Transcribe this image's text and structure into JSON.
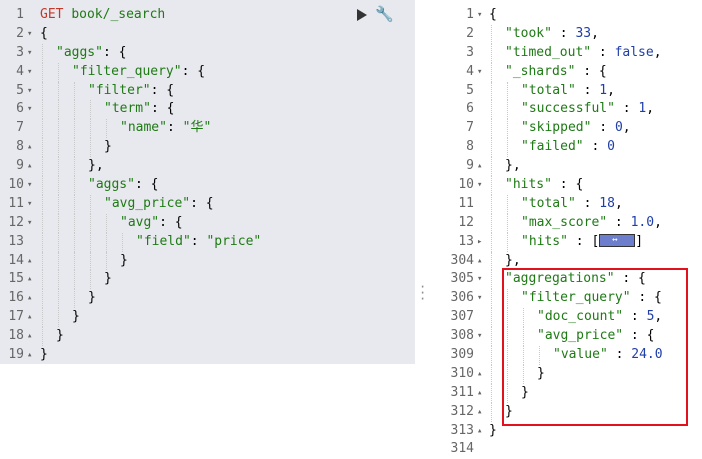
{
  "request": {
    "method": "GET",
    "endpoint": "book/_search",
    "lines": [
      {
        "n": "1",
        "fold": "",
        "indent": 0,
        "parts": []
      },
      {
        "n": "2",
        "fold": "▾",
        "indent": 0,
        "parts": [
          [
            "p",
            "{"
          ]
        ]
      },
      {
        "n": "3",
        "fold": "▾",
        "indent": 1,
        "parts": [
          [
            "s",
            "\"aggs\""
          ],
          [
            "p",
            ": {"
          ]
        ]
      },
      {
        "n": "4",
        "fold": "▾",
        "indent": 2,
        "parts": [
          [
            "s",
            "\"filter_query\""
          ],
          [
            "p",
            ": {"
          ]
        ]
      },
      {
        "n": "5",
        "fold": "▾",
        "indent": 3,
        "parts": [
          [
            "s",
            "\"filter\""
          ],
          [
            "p",
            ": {"
          ]
        ]
      },
      {
        "n": "6",
        "fold": "▾",
        "indent": 4,
        "parts": [
          [
            "s",
            "\"term\""
          ],
          [
            "p",
            ": {"
          ]
        ]
      },
      {
        "n": "7",
        "fold": "",
        "indent": 5,
        "parts": [
          [
            "s",
            "\"name\""
          ],
          [
            "p",
            ": "
          ],
          [
            "s",
            "\"华\""
          ]
        ]
      },
      {
        "n": "8",
        "fold": "▴",
        "indent": 4,
        "parts": [
          [
            "p",
            "}"
          ]
        ]
      },
      {
        "n": "9",
        "fold": "▴",
        "indent": 3,
        "parts": [
          [
            "p",
            "},"
          ]
        ]
      },
      {
        "n": "10",
        "fold": "▾",
        "indent": 3,
        "parts": [
          [
            "s",
            "\"aggs\""
          ],
          [
            "p",
            ": {"
          ]
        ]
      },
      {
        "n": "11",
        "fold": "▾",
        "indent": 4,
        "parts": [
          [
            "s",
            "\"avg_price\""
          ],
          [
            "p",
            ": {"
          ]
        ]
      },
      {
        "n": "12",
        "fold": "▾",
        "indent": 5,
        "parts": [
          [
            "s",
            "\"avg\""
          ],
          [
            "p",
            ": {"
          ]
        ]
      },
      {
        "n": "13",
        "fold": "",
        "indent": 6,
        "parts": [
          [
            "s",
            "\"field\""
          ],
          [
            "p",
            ": "
          ],
          [
            "s",
            "\"price\""
          ]
        ]
      },
      {
        "n": "14",
        "fold": "▴",
        "indent": 5,
        "parts": [
          [
            "p",
            "}"
          ]
        ]
      },
      {
        "n": "15",
        "fold": "▴",
        "indent": 4,
        "parts": [
          [
            "p",
            "}"
          ]
        ]
      },
      {
        "n": "16",
        "fold": "▴",
        "indent": 3,
        "parts": [
          [
            "p",
            "}"
          ]
        ]
      },
      {
        "n": "17",
        "fold": "▴",
        "indent": 2,
        "parts": [
          [
            "p",
            "}"
          ]
        ]
      },
      {
        "n": "18",
        "fold": "▴",
        "indent": 1,
        "parts": [
          [
            "p",
            "}"
          ]
        ]
      },
      {
        "n": "19",
        "fold": "▴",
        "indent": 0,
        "parts": [
          [
            "p",
            "}"
          ]
        ]
      }
    ]
  },
  "response": {
    "lines": [
      {
        "n": "1",
        "fold": "▾",
        "indent": 0,
        "parts": [
          [
            "p",
            "{"
          ]
        ]
      },
      {
        "n": "2",
        "fold": "",
        "indent": 1,
        "parts": [
          [
            "s",
            "\"took\""
          ],
          [
            "p",
            " : "
          ],
          [
            "n",
            "33"
          ],
          [
            "p",
            ","
          ]
        ]
      },
      {
        "n": "3",
        "fold": "",
        "indent": 1,
        "parts": [
          [
            "s",
            "\"timed_out\""
          ],
          [
            "p",
            " : "
          ],
          [
            "n",
            "false"
          ],
          [
            "p",
            ","
          ]
        ]
      },
      {
        "n": "4",
        "fold": "▾",
        "indent": 1,
        "parts": [
          [
            "s",
            "\"_shards\""
          ],
          [
            "p",
            " : {"
          ]
        ]
      },
      {
        "n": "5",
        "fold": "",
        "indent": 2,
        "parts": [
          [
            "s",
            "\"total\""
          ],
          [
            "p",
            " : "
          ],
          [
            "n",
            "1"
          ],
          [
            "p",
            ","
          ]
        ]
      },
      {
        "n": "6",
        "fold": "",
        "indent": 2,
        "parts": [
          [
            "s",
            "\"successful\""
          ],
          [
            "p",
            " : "
          ],
          [
            "n",
            "1"
          ],
          [
            "p",
            ","
          ]
        ]
      },
      {
        "n": "7",
        "fold": "",
        "indent": 2,
        "parts": [
          [
            "s",
            "\"skipped\""
          ],
          [
            "p",
            " : "
          ],
          [
            "n",
            "0"
          ],
          [
            "p",
            ","
          ]
        ]
      },
      {
        "n": "8",
        "fold": "",
        "indent": 2,
        "parts": [
          [
            "s",
            "\"failed\""
          ],
          [
            "p",
            " : "
          ],
          [
            "n",
            "0"
          ]
        ]
      },
      {
        "n": "9",
        "fold": "▴",
        "indent": 1,
        "parts": [
          [
            "p",
            "},"
          ]
        ]
      },
      {
        "n": "10",
        "fold": "▾",
        "indent": 1,
        "parts": [
          [
            "s",
            "\"hits\""
          ],
          [
            "p",
            " : {"
          ]
        ]
      },
      {
        "n": "11",
        "fold": "",
        "indent": 2,
        "parts": [
          [
            "s",
            "\"total\""
          ],
          [
            "p",
            " : "
          ],
          [
            "n",
            "18"
          ],
          [
            "p",
            ","
          ]
        ]
      },
      {
        "n": "12",
        "fold": "",
        "indent": 2,
        "parts": [
          [
            "s",
            "\"max_score\""
          ],
          [
            "p",
            " : "
          ],
          [
            "n",
            "1.0"
          ],
          [
            "p",
            ","
          ]
        ]
      },
      {
        "n": "13",
        "fold": "▸",
        "indent": 2,
        "parts": [
          [
            "s",
            "\"hits\""
          ],
          [
            "p",
            " : ["
          ],
          [
            "badge",
            ""
          ],
          [
            "p",
            "]"
          ]
        ]
      },
      {
        "n": "304",
        "fold": "▴",
        "indent": 1,
        "parts": [
          [
            "p",
            "},"
          ]
        ]
      },
      {
        "n": "305",
        "fold": "▾",
        "indent": 1,
        "parts": [
          [
            "s",
            "\"aggregations\""
          ],
          [
            "p",
            " : {"
          ]
        ]
      },
      {
        "n": "306",
        "fold": "▾",
        "indent": 2,
        "parts": [
          [
            "s",
            "\"filter_query\""
          ],
          [
            "p",
            " : {"
          ]
        ]
      },
      {
        "n": "307",
        "fold": "",
        "indent": 3,
        "parts": [
          [
            "s",
            "\"doc_count\""
          ],
          [
            "p",
            " : "
          ],
          [
            "n",
            "5"
          ],
          [
            "p",
            ","
          ]
        ]
      },
      {
        "n": "308",
        "fold": "▾",
        "indent": 3,
        "parts": [
          [
            "s",
            "\"avg_price\""
          ],
          [
            "p",
            " : {"
          ]
        ]
      },
      {
        "n": "309",
        "fold": "",
        "indent": 4,
        "parts": [
          [
            "s",
            "\"value\""
          ],
          [
            "p",
            " : "
          ],
          [
            "n",
            "24.0"
          ]
        ]
      },
      {
        "n": "310",
        "fold": "▴",
        "indent": 3,
        "parts": [
          [
            "p",
            "}"
          ]
        ]
      },
      {
        "n": "311",
        "fold": "▴",
        "indent": 2,
        "parts": [
          [
            "p",
            "}"
          ]
        ]
      },
      {
        "n": "312",
        "fold": "▴",
        "indent": 1,
        "parts": [
          [
            "p",
            "}"
          ]
        ]
      },
      {
        "n": "313",
        "fold": "▴",
        "indent": 0,
        "parts": [
          [
            "p",
            "}"
          ]
        ]
      },
      {
        "n": "314",
        "fold": "",
        "indent": 0,
        "parts": []
      }
    ]
  },
  "icons": {
    "run": "play-icon",
    "settings": "wrench-icon",
    "hits_collapsed": "collapsed-array-icon"
  },
  "colors": {
    "string": "#1e7a14",
    "number": "#1f3ea8",
    "method": "#c0392b",
    "highlight": "#e3111e",
    "editor_bg": "#e8e9ee"
  }
}
